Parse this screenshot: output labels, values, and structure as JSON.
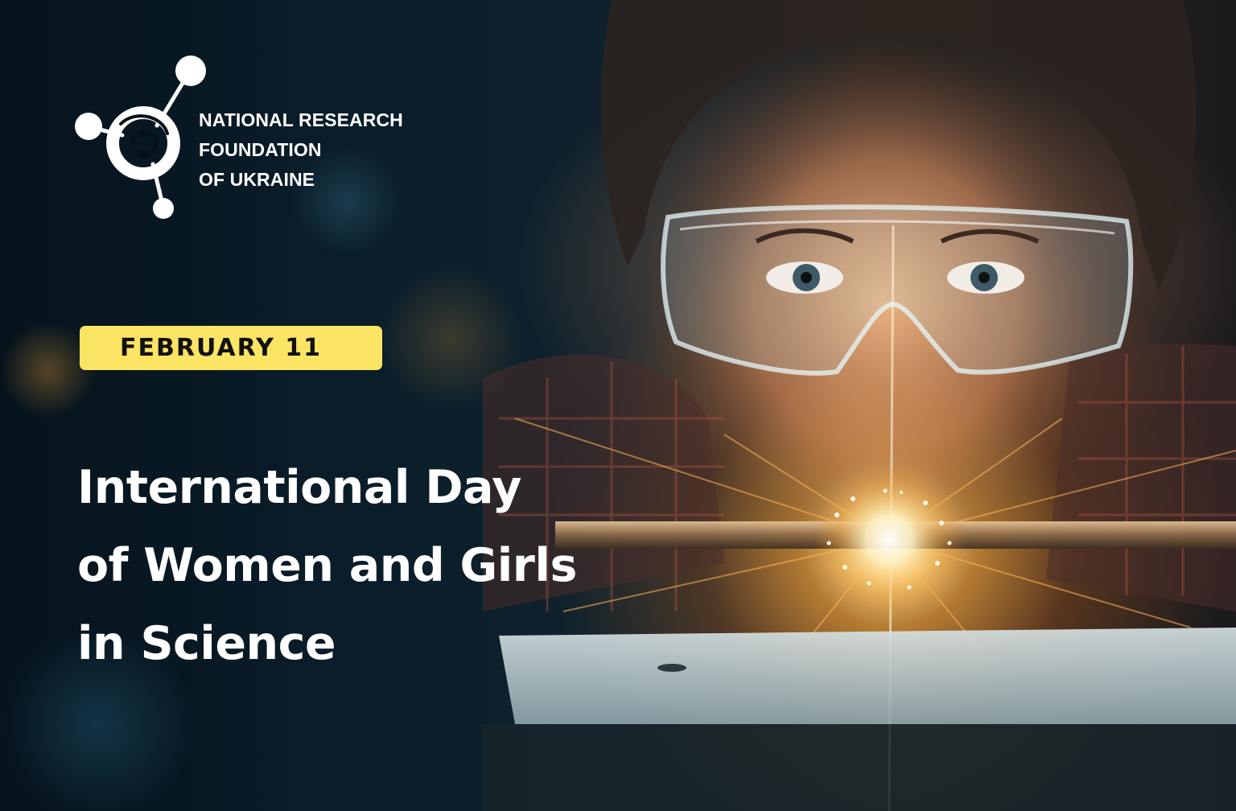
{
  "organization": {
    "name_lines": [
      "NATIONAL RESEARCH",
      "FOUNDATION",
      "OF UKRAINE"
    ]
  },
  "badge": {
    "date": "FEBRUARY 11"
  },
  "headline": {
    "lines": [
      "International Day",
      "of Women and Girls",
      "in Science"
    ]
  },
  "colors": {
    "badge_background": "#fce464",
    "badge_text": "#111111",
    "text_primary": "#ffffff",
    "background_dark": "#06131c"
  },
  "icons": {
    "logo": "molecule-spiral-logo-icon"
  }
}
